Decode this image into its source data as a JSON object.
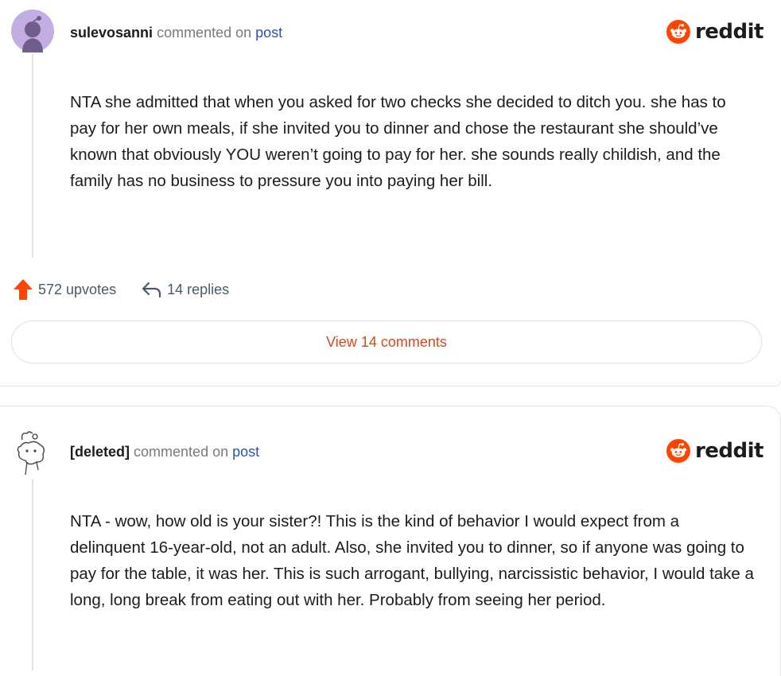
{
  "comments": [
    {
      "username": "sulevosanni",
      "commented": "commented on",
      "post_link": "post",
      "logo_text": "reddit",
      "body": "NTA she admitted that when you asked for two checks she decided to ditch you. she has to pay for her own meals, if she invited you to dinner and chose the restaurant she should’ve known that obviously YOU weren’t going to pay for her. she sounds really childish, and the family has no business to pressure you into paying her bill.",
      "upvotes": "572 upvotes",
      "replies": "14 replies",
      "view_comments": "View 14 comments"
    },
    {
      "username": "[deleted]",
      "commented": "commented on",
      "post_link": "post",
      "logo_text": "reddit",
      "body": "NTA - wow, how old is your sister?! This is the kind of behavior I would expect from a delinquent 16-year-old, not an adult. Also, she invited you to dinner, so if anyone was going to pay for the table, it was her. This is such arrogant, bullying, narcissistic behavior, I would take a long, long break from eating out with her. Probably from seeing her period."
    }
  ],
  "colors": {
    "brand": "#ff4500",
    "upvote": "#ff4500",
    "link": "#2a53b3",
    "view_button_text": "#d24a1c",
    "avatar_purple": "#b59fd8"
  },
  "icons": [
    "snoo-avatar-icon",
    "reddit-logo-icon",
    "upvote-arrow-icon",
    "reply-arrow-icon",
    "deleted-user-avatar-icon"
  ]
}
